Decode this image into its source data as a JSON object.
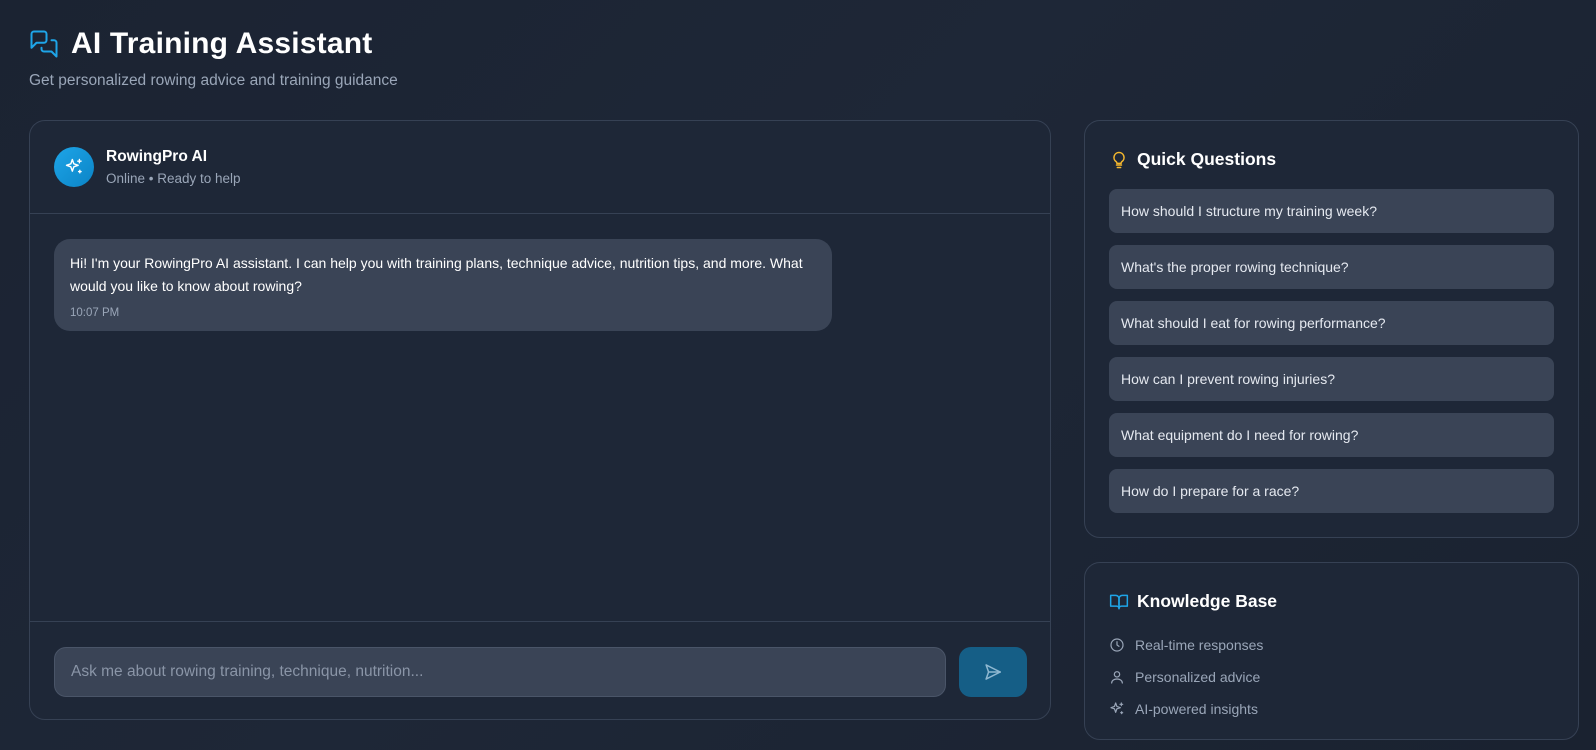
{
  "header": {
    "title": "AI Training Assistant",
    "subtitle": "Get personalized rowing advice and training guidance",
    "icon": "chat-bubbles-icon"
  },
  "chat": {
    "bot_name": "RowingPro AI",
    "bot_status": "Online • Ready to help",
    "avatar_icon": "sparkles-icon",
    "messages": [
      {
        "sender": "bot",
        "text": "Hi! I'm your RowingPro AI assistant. I can help you with training plans, technique advice, nutrition tips, and more. What would you like to know about rowing?",
        "time": "10:07 PM"
      }
    ],
    "input": {
      "placeholder": "Ask me about rowing training, technique, nutrition...",
      "value": ""
    },
    "send_icon": "send-icon"
  },
  "quick_questions": {
    "title": "Quick Questions",
    "icon": "lightbulb-icon",
    "items": [
      "How should I structure my training week?",
      "What's the proper rowing technique?",
      "What should I eat for rowing performance?",
      "How can I prevent rowing injuries?",
      "What equipment do I need for rowing?",
      "How do I prepare for a race?"
    ]
  },
  "knowledge_base": {
    "title": "Knowledge Base",
    "icon": "book-icon",
    "items": [
      {
        "label": "Real-time responses",
        "icon": "clock-icon"
      },
      {
        "label": "Personalized advice",
        "icon": "user-icon"
      },
      {
        "label": "AI-powered insights",
        "icon": "sparkles-icon"
      }
    ]
  },
  "colors": {
    "accent": "#1ea5e8",
    "lightbulb": "#f5b82e",
    "panel_bg": "#1e2737",
    "bubble_bg": "#3a4456",
    "send_bg": "#155e86"
  }
}
